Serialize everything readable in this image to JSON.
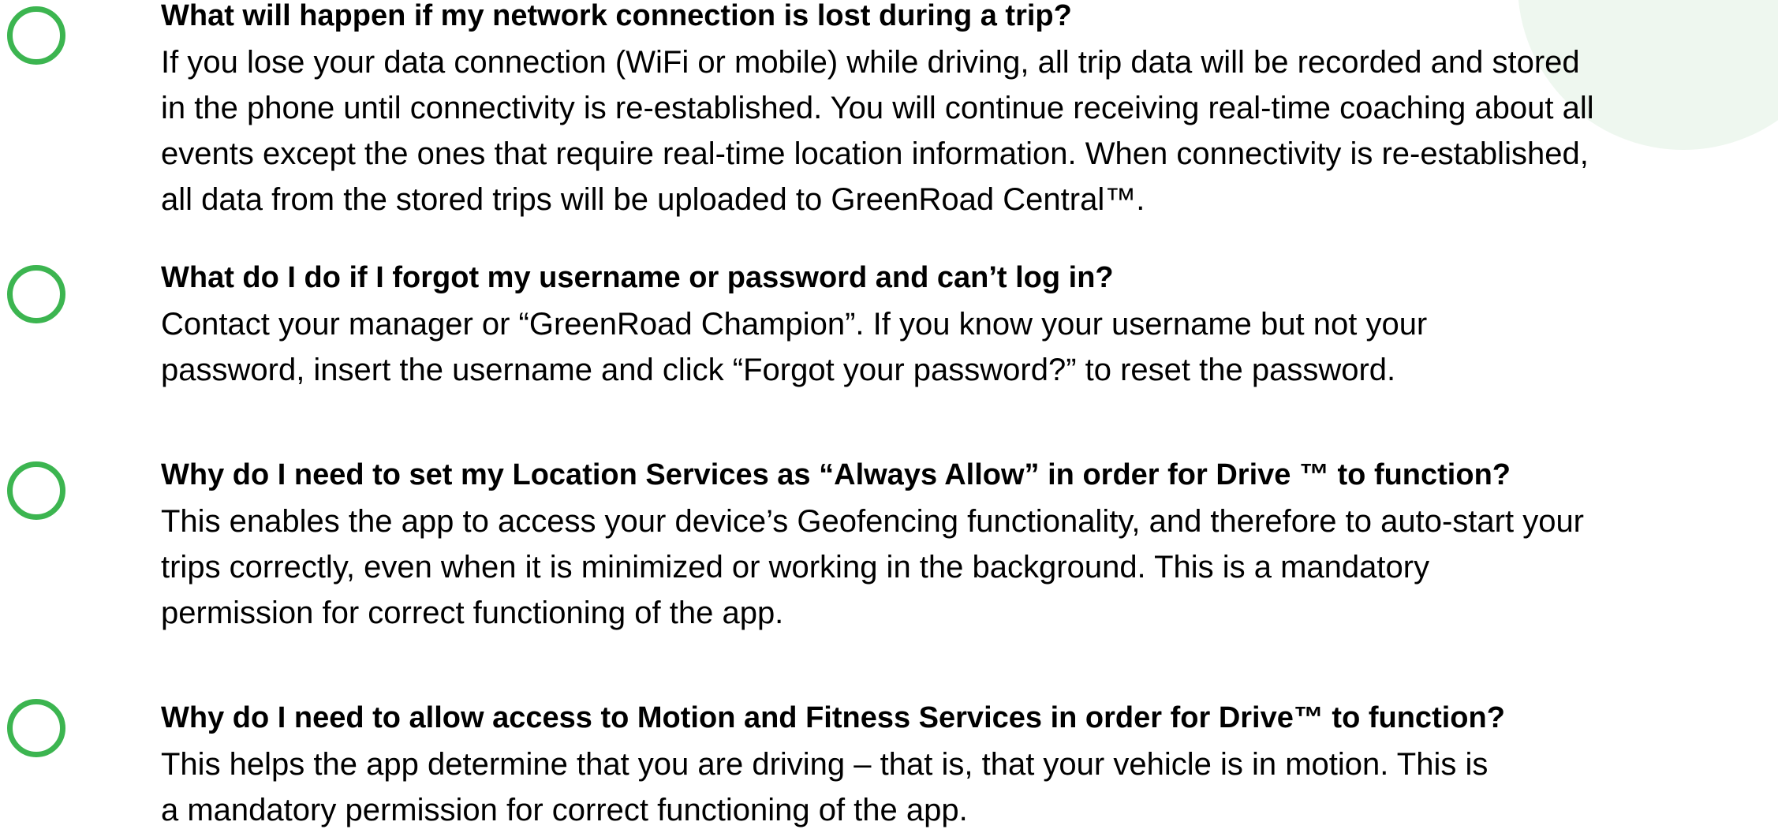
{
  "accent_color": "#3cb550",
  "faqs": [
    {
      "question": "What will happen if my network connection is lost during a trip?",
      "answer_lines": [
        "If you lose your data connection (WiFi or mobile) while driving, all trip data will be recorded and stored",
        "in the phone until connectivity is re-established. You will continue receiving real-time coaching about all",
        "events except the ones that require real-time location information. When connectivity is re-established,",
        "all data from the stored trips will be uploaded to GreenRoad Central™."
      ]
    },
    {
      "question": "What do I do if I forgot my username or password and can’t log in?",
      "answer_lines": [
        "Contact your manager or “GreenRoad Champion”. If you know your username but not your",
        "password, insert the username and click “Forgot your password?” to reset the password."
      ]
    },
    {
      "question": "Why do I need to set my Location Services as “Always Allow” in order for Drive ™ to function?",
      "answer_lines": [
        "This enables the app to access your device’s Geofencing functionality, and therefore to auto-start your",
        "trips correctly, even when it is minimized or working in the background. This is a mandatory",
        "permission for correct functioning of the app."
      ]
    },
    {
      "question": "Why do I need to allow access to Motion and Fitness Services in order for Drive™ to function?",
      "answer_lines": [
        "This helps the app determine that you are driving – that is, that your vehicle is in motion. This is",
        "a mandatory permission for correct functioning of the app."
      ]
    }
  ]
}
